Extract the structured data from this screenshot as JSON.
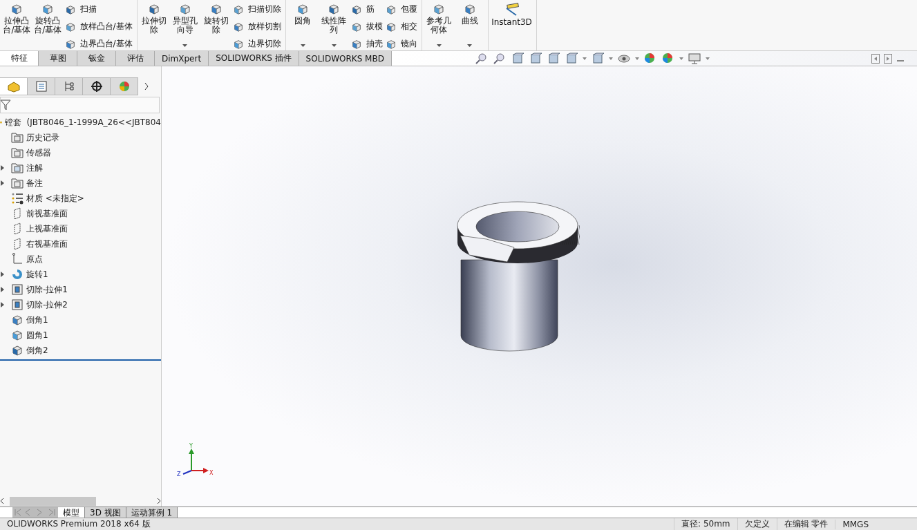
{
  "ribbon": {
    "groups": [
      {
        "items": [
          {
            "kind": "large",
            "label": "拉伸凸台/基体",
            "dropdown": false
          },
          {
            "kind": "large",
            "label": "旋转凸台/基体",
            "dropdown": false
          },
          {
            "kind": "stack",
            "items": [
              "扫描",
              "放样凸台/基体",
              "边界凸台/基体"
            ]
          }
        ]
      },
      {
        "items": [
          {
            "kind": "large",
            "label": "拉伸切除",
            "dropdown": false
          },
          {
            "kind": "large",
            "label": "异型孔向导",
            "dropdown": true
          },
          {
            "kind": "large",
            "label": "旋转切除",
            "dropdown": false
          },
          {
            "kind": "stack",
            "items": [
              "扫描切除",
              "放样切割",
              "边界切除"
            ]
          }
        ]
      },
      {
        "items": [
          {
            "kind": "large",
            "label": "圆角",
            "dropdown": true
          },
          {
            "kind": "large",
            "label": "线性阵列",
            "dropdown": true
          },
          {
            "kind": "stack",
            "items": [
              "筋",
              "拔模",
              "抽壳"
            ]
          },
          {
            "kind": "stack",
            "items": [
              "包覆",
              "相交",
              "镜向"
            ]
          }
        ]
      },
      {
        "items": [
          {
            "kind": "large",
            "label": "参考几何体",
            "dropdown": true
          },
          {
            "kind": "large",
            "label": "曲线",
            "dropdown": true
          }
        ]
      },
      {
        "items": [
          {
            "kind": "wide",
            "label": "Instant3D",
            "dropdown": false
          }
        ]
      }
    ]
  },
  "tabs": [
    {
      "label": "特征",
      "selected": true
    },
    {
      "label": "草图",
      "selected": false
    },
    {
      "label": "钣金",
      "selected": false
    },
    {
      "label": "评估",
      "selected": false
    },
    {
      "label": "DimXpert",
      "selected": false
    },
    {
      "label": "SOLIDWORKS 插件",
      "selected": false
    },
    {
      "label": "SOLIDWORKS MBD",
      "selected": false
    }
  ],
  "panel_tabs": [
    {
      "selected": true
    },
    {
      "selected": false
    },
    {
      "selected": false
    },
    {
      "selected": false
    },
    {
      "selected": false
    }
  ],
  "tree": {
    "label": "镗套  (JBT8046_1-1999A_26<<JBT804",
    "children": [
      {
        "label": "历史记录"
      },
      {
        "label": "传感器"
      },
      {
        "label": "注解",
        "expanded": false
      },
      {
        "label": "备注",
        "expanded": false
      },
      {
        "label": "材质 <未指定>"
      },
      {
        "label": "前视基准面"
      },
      {
        "label": "上视基准面"
      },
      {
        "label": "右视基准面"
      },
      {
        "label": "原点"
      },
      {
        "label": "旋转1",
        "expanded": false
      },
      {
        "label": "切除-拉伸1",
        "expanded": false
      },
      {
        "label": "切除-拉伸2",
        "expanded": false
      },
      {
        "label": "倒角1"
      },
      {
        "label": "圆角1"
      },
      {
        "label": "倒角2"
      }
    ]
  },
  "triad": {
    "x": "X",
    "y": "Y",
    "z": "Z"
  },
  "bottom_tabs": [
    {
      "label": "模型",
      "selected": true
    },
    {
      "label": "3D 视图",
      "selected": false
    },
    {
      "label": "运动算例 1",
      "selected": false
    }
  ],
  "status_bar": {
    "product": "OLIDWORKS Premium 2018 x64 版",
    "fields": [
      "直径: 50mm",
      "欠定义",
      "在编辑 零件",
      "MMGS"
    ]
  }
}
